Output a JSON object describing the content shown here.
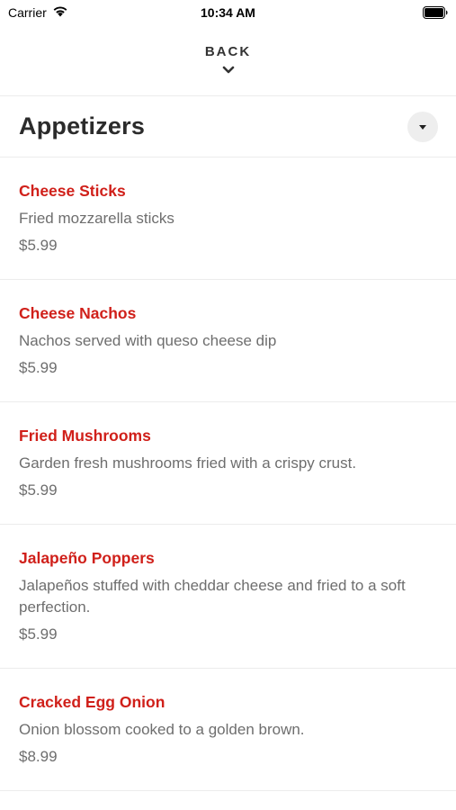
{
  "status_bar": {
    "carrier": "Carrier",
    "time": "10:34 AM",
    "icons": [
      "wifi-icon",
      "battery-icon"
    ]
  },
  "nav": {
    "back_label": "BACK",
    "back_icon": "chevron-down-icon"
  },
  "section": {
    "title": "Appetizers",
    "toggle_icon": "caret-down-icon"
  },
  "colors": {
    "item_name": "#d0201a",
    "text_secondary": "#6e6e6e",
    "divider": "#ececec"
  },
  "items": [
    {
      "name": "Cheese Sticks",
      "description": "Fried mozzarella sticks",
      "price": "$5.99"
    },
    {
      "name": "Cheese Nachos",
      "description": "Nachos served with queso cheese dip",
      "price": "$5.99"
    },
    {
      "name": "Fried Mushrooms",
      "description": "Garden fresh mushrooms fried with a crispy crust.",
      "price": "$5.99"
    },
    {
      "name": "Jalapeño Poppers",
      "description": "Jalapeños stuffed with cheddar cheese and fried to a soft perfection.",
      "price": "$5.99"
    },
    {
      "name": "Cracked Egg Onion",
      "description": "Onion blossom cooked to a golden brown.",
      "price": "$8.99"
    }
  ]
}
